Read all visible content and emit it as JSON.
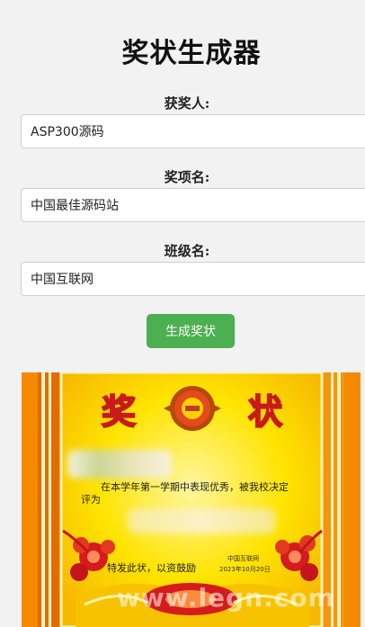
{
  "page": {
    "title": "奖状生成器"
  },
  "form": {
    "winner": {
      "label": "获奖人:",
      "value": "ASP300源码"
    },
    "award": {
      "label": "奖项名:",
      "value": "中国最佳源码站"
    },
    "class_name": {
      "label": "班级名:",
      "value": "中国互联网"
    },
    "submit_label": "生成奖状"
  },
  "certificate": {
    "heading_left": "奖",
    "heading_right": "状",
    "body_line1": "在本学年第一学期中表现优秀，被我校决定",
    "body_line2": "评为",
    "closing": "特发此状，以资鼓励",
    "issuer": "中国互联网",
    "date": "2023年10月20日",
    "watermark": "www.legn.com"
  },
  "colors": {
    "accent_button": "#4caf50",
    "cert_orange": "#f08a0a",
    "cert_yellow": "#ffe200",
    "cert_red": "#d51b1b"
  }
}
